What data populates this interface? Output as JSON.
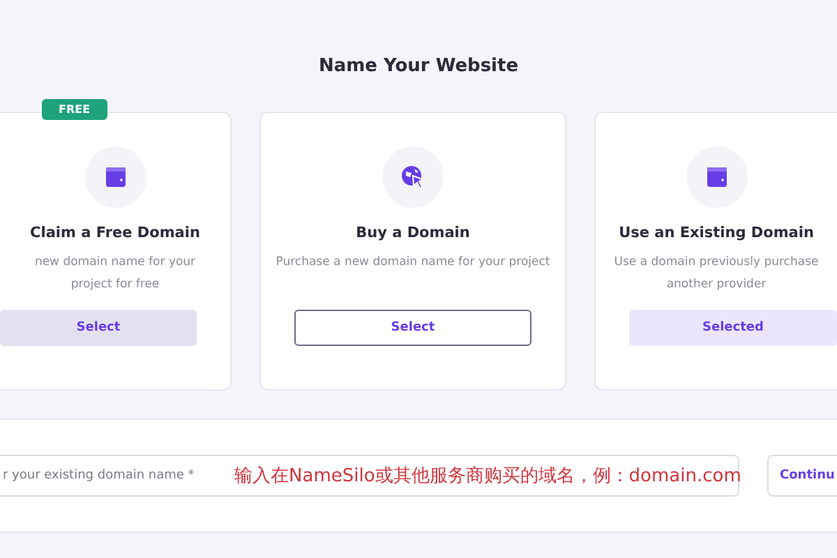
{
  "title": "Name Your Website",
  "options": [
    {
      "badge": "FREE",
      "heading": "Claim a Free Domain",
      "description": "new domain name for your project for free",
      "button": {
        "label": "Select",
        "kind": "filled"
      },
      "selected": false
    },
    {
      "heading": "Buy a Domain",
      "description": "Purchase a new domain name for your project",
      "button": {
        "label": "Select",
        "kind": "outline"
      },
      "selected": false
    },
    {
      "heading": "Use an Existing Domain",
      "description": "Use a domain previously purchase another provider",
      "button": {
        "label": "Selected",
        "kind": "filled"
      },
      "selected": true
    }
  ],
  "domain_field": {
    "placeholder": "r your existing domain name *",
    "annotation": "输入在NameSilo或其他服务商购买的域名，例：domain.com"
  },
  "continue_button": "Continu"
}
